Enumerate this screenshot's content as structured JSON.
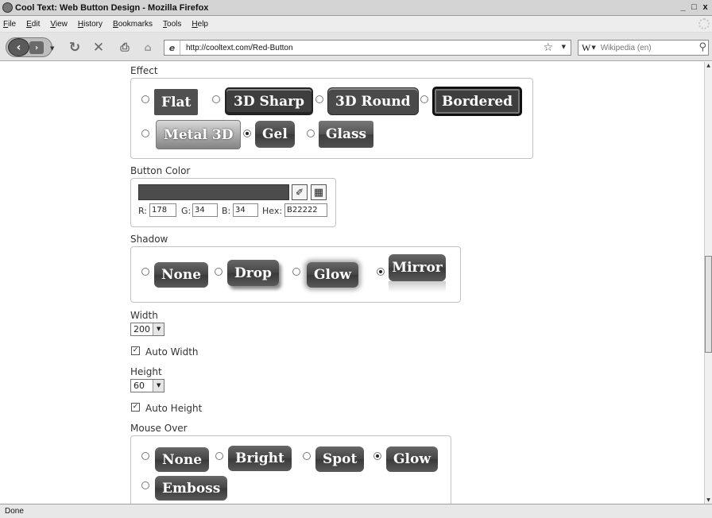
{
  "window": {
    "title": "Cool Text: Web Button Design - Mozilla Firefox",
    "controls": [
      "_",
      "๑",
      "x"
    ]
  },
  "menu": [
    "File",
    "Edit",
    "View",
    "History",
    "Bookmarks",
    "Tools",
    "Help"
  ],
  "toolbar": {
    "url": "http://cooltext.com/Red-Button",
    "search_placeholder": "Wikipedia (en)",
    "search_engine_icon": "W"
  },
  "status": "Done",
  "effect": {
    "label": "Effect",
    "options": [
      {
        "label": "Flat",
        "selected": false
      },
      {
        "label": "3D Sharp",
        "selected": false
      },
      {
        "label": "3D Round",
        "selected": false
      },
      {
        "label": "Bordered",
        "selected": false
      },
      {
        "label": "Metal 3D",
        "selected": false
      },
      {
        "label": "Gel",
        "selected": true
      },
      {
        "label": "Glass",
        "selected": false
      }
    ]
  },
  "button_color": {
    "label": "Button Color",
    "r_label": "R:",
    "r": "178",
    "g_label": "G:",
    "g": "34",
    "b_label": "B:",
    "b": "34",
    "hex_label": "Hex:",
    "hex": "B22222"
  },
  "shadow": {
    "label": "Shadow",
    "options": [
      {
        "label": "None",
        "selected": false
      },
      {
        "label": "Drop",
        "selected": false
      },
      {
        "label": "Glow",
        "selected": false
      },
      {
        "label": "Mirror",
        "selected": true
      }
    ]
  },
  "width": {
    "label": "Width",
    "value": "200",
    "auto_label": "Auto Width",
    "auto": true
  },
  "height": {
    "label": "Height",
    "value": "60",
    "auto_label": "Auto Height",
    "auto": true
  },
  "mouse_over": {
    "label": "Mouse Over",
    "options": [
      {
        "label": "None",
        "selected": false
      },
      {
        "label": "Bright",
        "selected": false
      },
      {
        "label": "Spot",
        "selected": false
      },
      {
        "label": "Glow",
        "selected": true
      },
      {
        "label": "Emboss",
        "selected": false
      }
    ]
  }
}
